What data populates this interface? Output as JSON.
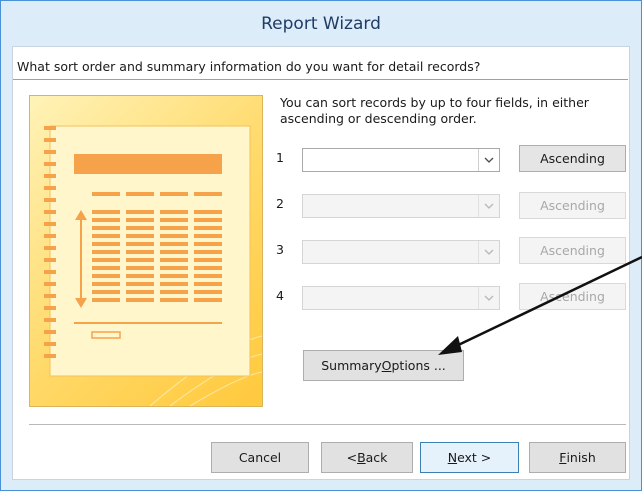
{
  "window": {
    "title": "Report Wizard"
  },
  "question": "What sort order and summary information do you want for detail records?",
  "instructions": "You can sort records by up to four fields, in either ascending or descending order.",
  "sort_rows": [
    {
      "number": "1",
      "value": "",
      "order": "Ascending",
      "enabled": true
    },
    {
      "number": "2",
      "value": "",
      "order": "Ascending",
      "enabled": false
    },
    {
      "number": "3",
      "value": "",
      "order": "Ascending",
      "enabled": false
    },
    {
      "number": "4",
      "value": "",
      "order": "Ascending",
      "enabled": false
    }
  ],
  "summary_button": {
    "pre": "Summary ",
    "mnemonic": "O",
    "post": "ptions ..."
  },
  "buttons": {
    "cancel": {
      "pre": "Cancel",
      "mnemonic": "",
      "post": ""
    },
    "back": {
      "pre": "< ",
      "mnemonic": "B",
      "post": "ack"
    },
    "next": {
      "pre": "",
      "mnemonic": "N",
      "post": "ext >"
    },
    "finish": {
      "pre": "",
      "mnemonic": "F",
      "post": "inish"
    }
  },
  "colors": {
    "accent_border": "#4a90d9",
    "titlebar_bg": "#dcecf9",
    "illustration_orange": "#f5a24b",
    "illustration_yellow": "#ffd866"
  }
}
